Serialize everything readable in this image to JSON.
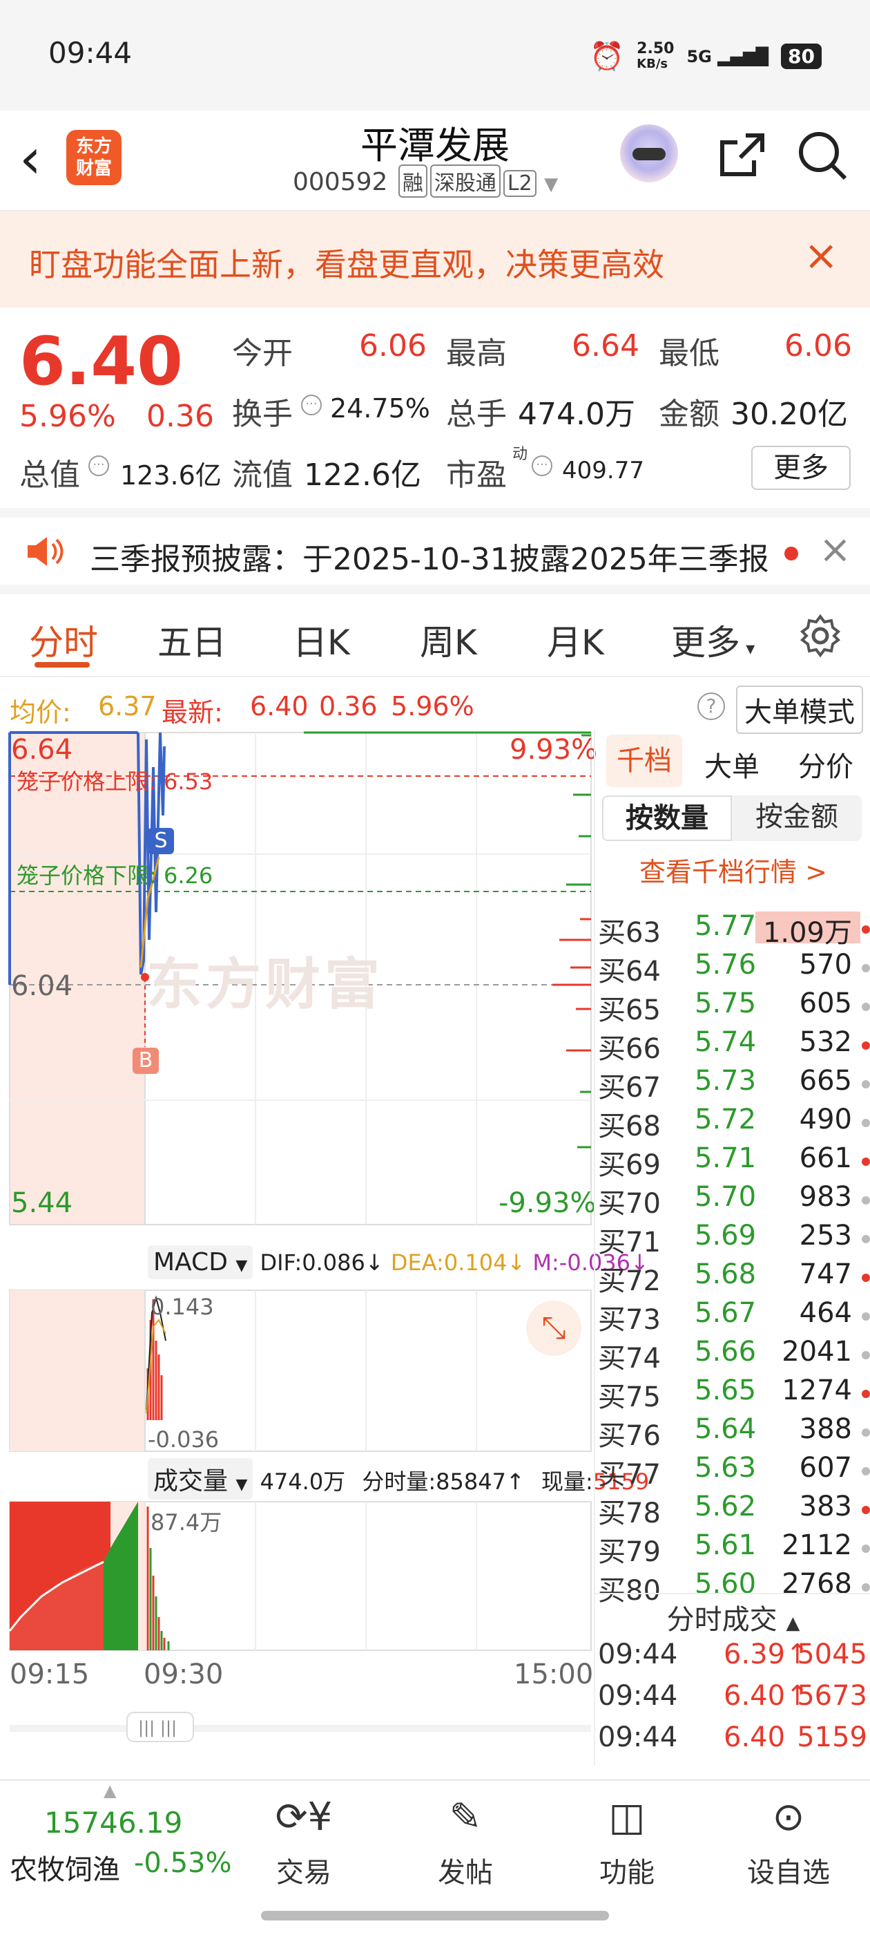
{
  "status_bar": {
    "time": "09:44",
    "net_speed": "2.50",
    "net_unit": "KB/s",
    "signal": "5G",
    "battery": "80"
  },
  "header": {
    "title": "平潭发展",
    "code": "000592",
    "tags": [
      "融",
      "深股通",
      "L2"
    ],
    "logo_line1": "东方",
    "logo_line2": "财富"
  },
  "banner": {
    "text": "盯盘功能全面上新，看盘更直观，决策更高效"
  },
  "quote": {
    "price": "6.40",
    "change_pct": "5.96%",
    "change": "0.36",
    "open_label": "今开",
    "open": "6.06",
    "high_label": "最高",
    "high": "6.64",
    "low_label": "最低",
    "low": "6.06",
    "turnover_label": "换手",
    "turnover": "24.75%",
    "volume_label": "总手",
    "volume": "474.0万",
    "amount_label": "金额",
    "amount": "30.20亿",
    "mktcap_label": "总值",
    "mktcap": "123.6亿",
    "float_label": "流值",
    "float_cap": "122.6亿",
    "pe_label": "市盈",
    "pe_sup": "动",
    "pe": "409.77",
    "more_label": "更多"
  },
  "notice": {
    "text": "三季报预披露：于2025-10-31披露2025年三季报"
  },
  "tabs": [
    "分时",
    "五日",
    "日K",
    "周K",
    "月K",
    "更多"
  ],
  "info_line": {
    "avg_label": "均价:",
    "avg": "6.37",
    "last_label": "最新:",
    "last": "6.40",
    "chg": "0.36",
    "pct": "5.96%",
    "mode_label": "大单模式"
  },
  "chart": {
    "y_top": "6.64",
    "y_mid": "6.04",
    "y_bot": "5.44",
    "pct_top": "9.93%",
    "pct_bot": "-9.93%",
    "upper_limit_label": "笼子价格上限:",
    "upper_limit": "6.53",
    "lower_limit_label": "笼子价格下限:",
    "lower_limit": "6.26",
    "watermark": "东方财富",
    "macd_label": "MACD",
    "dif": "DIF:0.086",
    "dea": "DEA:0.104",
    "m": "M:-0.036",
    "macd_top": "0.143",
    "macd_bot": "-0.036",
    "vol_label": "成交量",
    "vol_total": "474.0万",
    "vol_fs": "分时量:85847",
    "vol_now_label": "现量:",
    "vol_now": "5159",
    "vol_max": "87.4万",
    "time_start": "09:15",
    "time_open": "09:30",
    "time_end": "15:00",
    "marker_s": "S",
    "marker_b": "B"
  },
  "right_panel": {
    "tabs": [
      "千档",
      "大单",
      "分价"
    ],
    "subtabs": [
      "按数量",
      "按金额"
    ],
    "link": "查看千档行情 >",
    "rows": [
      {
        "label": "买63",
        "price": "5.77",
        "vol": "1.09万"
      },
      {
        "label": "买64",
        "price": "5.76",
        "vol": "570"
      },
      {
        "label": "买65",
        "price": "5.75",
        "vol": "605"
      },
      {
        "label": "买66",
        "price": "5.74",
        "vol": "532"
      },
      {
        "label": "买67",
        "price": "5.73",
        "vol": "665"
      },
      {
        "label": "买68",
        "price": "5.72",
        "vol": "490"
      },
      {
        "label": "买69",
        "price": "5.71",
        "vol": "661"
      },
      {
        "label": "买70",
        "price": "5.70",
        "vol": "983"
      },
      {
        "label": "买71",
        "price": "5.69",
        "vol": "253"
      },
      {
        "label": "买72",
        "price": "5.68",
        "vol": "747"
      },
      {
        "label": "买73",
        "price": "5.67",
        "vol": "464"
      },
      {
        "label": "买74",
        "price": "5.66",
        "vol": "2041"
      },
      {
        "label": "买75",
        "price": "5.65",
        "vol": "1274"
      },
      {
        "label": "买76",
        "price": "5.64",
        "vol": "388"
      },
      {
        "label": "买77",
        "price": "5.63",
        "vol": "607"
      },
      {
        "label": "买78",
        "price": "5.62",
        "vol": "383"
      },
      {
        "label": "买79",
        "price": "5.61",
        "vol": "2112"
      },
      {
        "label": "买80",
        "price": "5.60",
        "vol": "2768"
      }
    ],
    "trades_label": "分时成交",
    "trades": [
      {
        "time": "09:44",
        "price": "6.39",
        "vol": "5045",
        "arrow": "↑"
      },
      {
        "time": "09:44",
        "price": "6.40",
        "vol": "5673",
        "arrow": "↑"
      },
      {
        "time": "09:44",
        "price": "6.40",
        "vol": "5159",
        "arrow": ""
      }
    ]
  },
  "bottom_nav": {
    "index_value": "15746.19",
    "index_name": "农牧饲渔",
    "index_pct": "-0.53%",
    "items": [
      "交易",
      "发帖",
      "功能",
      "设自选"
    ]
  },
  "colors": {
    "up": "#e8382b",
    "down": "#2c9a2c",
    "accent": "#f05a28"
  }
}
